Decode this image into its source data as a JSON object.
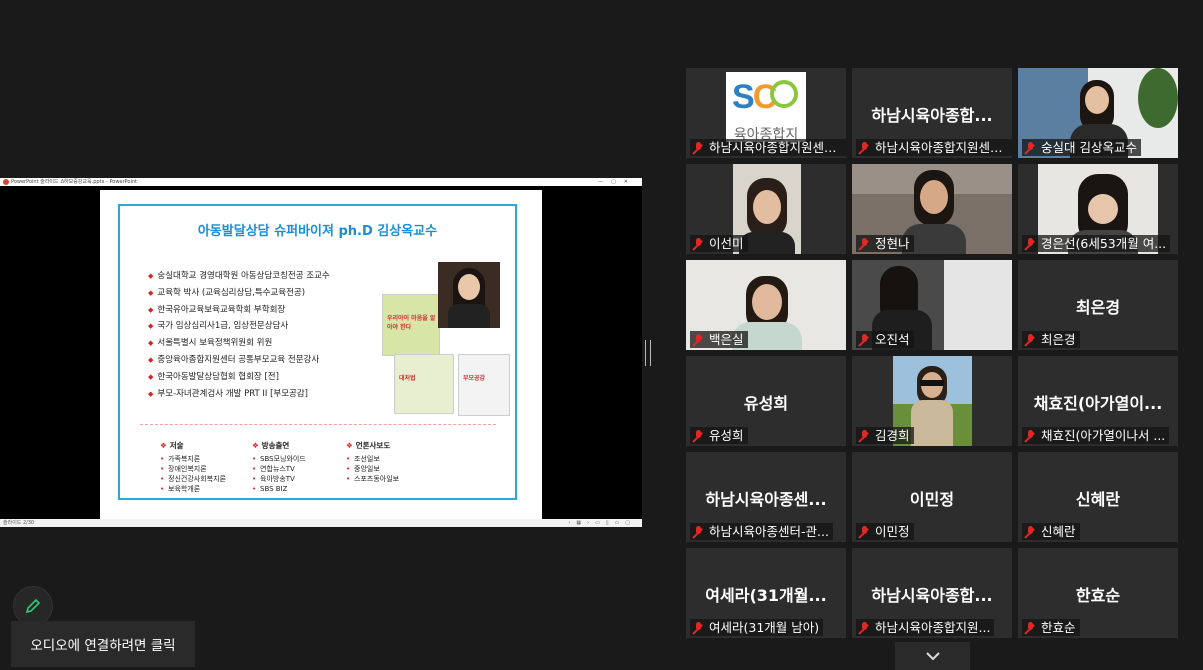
{
  "app": {
    "audio_prompt": "오디오에 연결하려면 클릭"
  },
  "powerpoint": {
    "window_title_left": "PowerPoint 슬라이드 쇼",
    "window_title_file": "하모증강교육.pptx - PowerPoint",
    "status_left": "슬라이드 2/30"
  },
  "slide": {
    "title": "아동발달상담 슈퍼바이져  ph.D 김상옥교수",
    "bullets": [
      "숭실대학교 경영대학원 아동상담코칭전공 조교수",
      "교육학 박사 (교육심리상담,특수교육전공)",
      "한국유아교육보육교육학회 부학회장",
      "국가 임상심리사1급, 임상전문상담사",
      "서울특별시 보육정책위원회 위원",
      "중앙육아종합지원센터 공통부모교육 전문강사",
      "한국아동발달상담협회 협회장 [전]",
      "부모-자녀관계검사 개발 PRT II [부모공감]"
    ],
    "book_titles": [
      "우리아이 마음을 알아야 한다",
      "대처법",
      "부모공감"
    ],
    "sections": [
      {
        "heading": "저술",
        "items": [
          "가족복지론",
          "장애인복지론",
          "정신건강사회복지론",
          "보육학개론"
        ]
      },
      {
        "heading": "방송출연",
        "items": [
          "SBS모닝와이드",
          "연합뉴스TV",
          "육아방송TV",
          "SBS BIZ"
        ]
      },
      {
        "heading": "언론사보도",
        "items": [
          "조선일보",
          "중앙일보",
          "스포츠동아일보"
        ]
      }
    ]
  },
  "participants": [
    {
      "name": "하남시육아종합지원센터 -관...",
      "big": "",
      "kind": "logo",
      "logo_text": "SC",
      "logo_sub": "육아종합지",
      "active": false
    },
    {
      "name": "하남시육아종합지원센터...",
      "big": "하남시육아종합...",
      "kind": "text",
      "active": false
    },
    {
      "name": "숭실대 김상옥교수",
      "big": "",
      "kind": "video-prof",
      "active": true
    },
    {
      "name": "이선미",
      "big": "",
      "kind": "video-a",
      "active": false
    },
    {
      "name": "정현나",
      "big": "",
      "kind": "video-b",
      "active": false
    },
    {
      "name": "경은선(6세53개월 여...",
      "big": "",
      "kind": "video-c",
      "active": false
    },
    {
      "name": "백은실",
      "big": "",
      "kind": "video-d",
      "active": false
    },
    {
      "name": "오진석",
      "big": "",
      "kind": "video-e",
      "active": false
    },
    {
      "name": "최은경",
      "big": "최은경",
      "kind": "text",
      "active": false
    },
    {
      "name": "유성희",
      "big": "유성희",
      "kind": "text",
      "active": false
    },
    {
      "name": "김경희",
      "big": "",
      "kind": "video-f",
      "active": false
    },
    {
      "name": "채효진(아가열이나서 ...",
      "big": "채효진(아가열이...",
      "kind": "text",
      "active": false
    },
    {
      "name": "하남시육아종센터-관...",
      "big": "하남시육아종센...",
      "kind": "text",
      "active": false
    },
    {
      "name": "이민정",
      "big": "이민정",
      "kind": "text",
      "active": false
    },
    {
      "name": "신혜란",
      "big": "신혜란",
      "kind": "text",
      "active": false
    },
    {
      "name": "여세라(31개월 남아)",
      "big": "여세라(31개월...",
      "kind": "text",
      "active": false
    },
    {
      "name": "하남시육아종합지원...",
      "big": "하남시육아종합...",
      "kind": "text",
      "active": false
    },
    {
      "name": "한효순",
      "big": "한효순",
      "kind": "text",
      "active": false
    }
  ],
  "colors": {
    "background": "#1a1a1a",
    "tile": "#2d2d2d",
    "active_border": "#b9e031",
    "muted_mic": "#e02828",
    "slide_accent": "#2aa8d8"
  },
  "icons": {
    "mic": "muted-mic-icon",
    "edit": "pencil-icon",
    "more": "chevron-down-icon"
  }
}
